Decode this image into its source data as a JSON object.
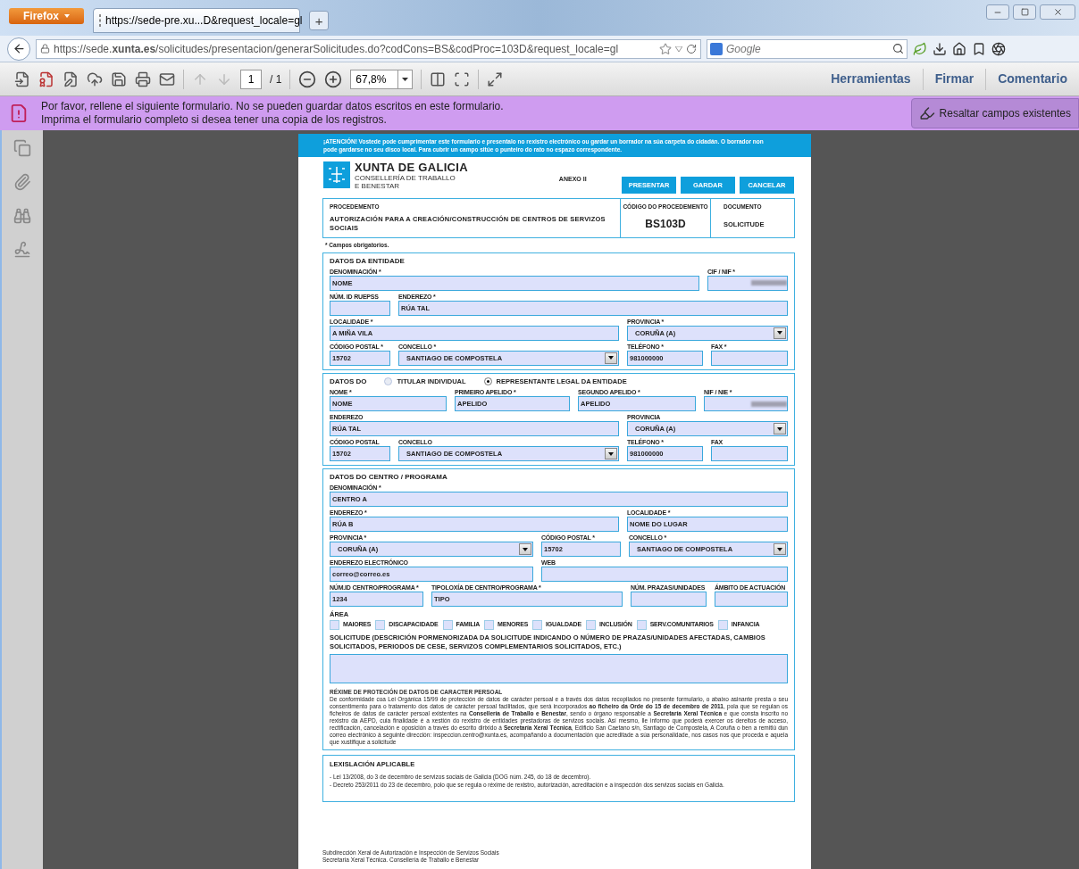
{
  "browser": {
    "menu_button": "Firefox",
    "tab": {
      "title": "https://sede-pre.xu...D&request_locale=gl",
      "new_tab": "+"
    },
    "address": "https://sede.**xunta.es**/solicitudes/presentacion/generarSolicitudes.do?codCons=BS&codProc=103D&request_locale=gl",
    "search": {
      "placeholder": "Google"
    }
  },
  "pdf_toolbar": {
    "page": "1",
    "page_count": "/ 1",
    "zoom": "67,8%",
    "menus": [
      "Herramientas",
      "Firmar",
      "Comentario"
    ]
  },
  "notice": {
    "lines": [
      "Por favor, rellene el siguiente formulario. No se pueden guardar datos escritos en este formulario.",
      "Imprima el formulario completo si desea tener una copia de los registros."
    ],
    "button": "Resaltar campos existentes"
  },
  "form": {
    "banner": "¡ATENCIÓN! Vostede pode cumprimentar este formulario e presentalo no rexistro electrónico ou gardar un borrador na súa carpeta do cidadán. O borrador non pode gardarse no seu disco local. Para cubrir un campo sitúe o punteiro do rato no espazo correspondente.",
    "logo": {
      "title": "XUNTA DE GALICIA",
      "subtitle": [
        "CONSELLERÍA DE TRABALLO",
        "E BENESTAR"
      ]
    },
    "annex": "ANEXO II",
    "buttons": [
      "PRESENTAR",
      "GARDAR",
      "CANCELAR"
    ],
    "procedure": {
      "label": "PROCEDEMENTO",
      "value": "AUTORIZACIÓN PARA A CREACIÓN/CONSTRUCCIÓN DE CENTROS DE SERVIZOS SOCIAIS"
    },
    "code": {
      "label": "CÓDIGO DO PROCEDEMENTO",
      "value": "BS103D"
    },
    "document": {
      "label": "DOCUMENTO",
      "value": "SOLICITUDE"
    },
    "required_note": "* Campos obrigatorios.",
    "sections": [
      {
        "title": "DATOS DA ENTIDADE",
        "rows": [
          {
            "fields": [
              {
                "kind": "text",
                "label": "DENOMINACIÓN *",
                "value": "NOME"
              },
              {
                "kind": "text",
                "label": "CIF / NIF *",
                "redacted": true
              }
            ]
          },
          {
            "fields": [
              {
                "kind": "text",
                "label": "NÚM. ID RUEPSS"
              },
              {
                "kind": "text",
                "label": "ENDEREZO *",
                "value": "RÚA TAL"
              }
            ]
          },
          {
            "fields": [
              {
                "kind": "text",
                "label": "LOCALIDADE *",
                "value": "A MIÑA VILA"
              },
              {
                "kind": "select",
                "label": "PROVINCIA *",
                "value": "CORUÑA (A)"
              }
            ]
          },
          {
            "fields": [
              {
                "kind": "text",
                "label": "CÓDIGO POSTAL *",
                "value": "15702"
              },
              {
                "kind": "select",
                "label": "CONCELLO *",
                "value": "SANTIAGO DE COMPOSTELA"
              },
              {
                "kind": "text",
                "label": "TELÉFONO *",
                "value": "981000000"
              },
              {
                "kind": "text",
                "label": "FAX *"
              }
            ]
          }
        ]
      },
      {
        "title": "DATOS DO",
        "options": [
          {
            "label": "TITULAR INDIVIDUAL",
            "selected": false
          },
          {
            "label": "REPRESENTANTE LEGAL DA ENTIDADE",
            "selected": true
          }
        ],
        "rows": [
          {
            "fields": [
              {
                "kind": "text",
                "label": "NOME *",
                "value": "NOME"
              },
              {
                "kind": "text",
                "label": "PRIMEIRO APELIDO *",
                "value": "APELIDO"
              },
              {
                "kind": "text",
                "label": "SEGUNDO APELIDO *",
                "value": "APELIDO"
              },
              {
                "kind": "text",
                "label": "NIF / NIE *",
                "redacted": true
              }
            ]
          },
          {
            "fields": [
              {
                "kind": "text",
                "label": "ENDEREZO",
                "value": "RÚA TAL"
              },
              {
                "kind": "select",
                "label": "PROVINCIA",
                "value": "CORUÑA (A)"
              }
            ]
          },
          {
            "fields": [
              {
                "kind": "text",
                "label": "CÓDIGO POSTAL",
                "value": "15702"
              },
              {
                "kind": "select",
                "label": "CONCELLO",
                "value": "SANTIAGO DE COMPOSTELA"
              },
              {
                "kind": "text",
                "label": "TELÉFONO *",
                "value": "981000000"
              },
              {
                "kind": "text",
                "label": "FAX"
              }
            ]
          }
        ]
      },
      {
        "title": "DATOS DO CENTRO / PROGRAMA",
        "rows": [
          {
            "fields": [
              {
                "kind": "text",
                "label": "DENOMINACIÓN *",
                "value": "CENTRO A"
              }
            ]
          },
          {
            "fields": [
              {
                "kind": "text",
                "label": "ENDEREZO *",
                "value": "RÚA B"
              },
              {
                "kind": "text",
                "label": "LOCALIDADE *",
                "value": "NOME DO LUGAR"
              }
            ]
          },
          {
            "fields": [
              {
                "kind": "select",
                "label": "PROVINCIA *",
                "value": "CORUÑA (A)"
              },
              {
                "kind": "text",
                "label": "CÓDIGO POSTAL *",
                "value": "15702"
              },
              {
                "kind": "select",
                "label": "CONCELLO *",
                "value": "SANTIAGO DE COMPOSTELA"
              }
            ]
          },
          {
            "fields": [
              {
                "kind": "text",
                "label": "ENDEREZO ELECTRÓNICO",
                "value": "correo@correo.es"
              },
              {
                "kind": "text",
                "label": "WEB"
              }
            ]
          },
          {
            "fields": [
              {
                "kind": "text",
                "label": "NÚM.ID CENTRO/PROGRAMA *",
                "value": "1234"
              },
              {
                "kind": "text",
                "label": "TIPOLOXÍA DE CENTRO/PROGRAMA *",
                "value": "TIPO"
              },
              {
                "kind": "text",
                "label": "NÚM. PRAZAS/UNIDADES"
              },
              {
                "kind": "text",
                "label": "ÁMBITO DE ACTUACIÓN"
              }
            ]
          }
        ],
        "area": {
          "label": "ÁREA",
          "options": [
            {
              "label": "MAIORES",
              "checked": false
            },
            {
              "label": "DISCAPACIDADE",
              "checked": false
            },
            {
              "label": "FAMILIA",
              "checked": false
            },
            {
              "label": "MENORES",
              "checked": false
            },
            {
              "label": "IGUALDADE",
              "checked": false
            },
            {
              "label": "INCLUSIÓN",
              "checked": false
            },
            {
              "label": "SERV.COMUNITARIOS",
              "checked": false
            },
            {
              "label": "INFANCIA",
              "checked": false
            }
          ]
        },
        "request": {
          "label": "SOLICITUDE (DESCRICIÓN PORMENORIZADA DA SOLICITUDE INDICANDO O NÚMERO DE PRAZAS/UNIDADES AFECTADAS, CAMBIOS SOLICITADOS, PERIODOS DE CESE, SERVIZOS COMPLEMENTARIOS SOLICITADOS, ETC.)"
        },
        "privacy": {
          "title": "RÉXIME DE PROTECIÓN DE DATOS DE CARACTER PERSOAL",
          "text": "De conformidade coa Lei Orgánica 15/99 de protección de datos de carácter persoal e a través dos datos recopilados no presente formulario, o abaixo asinante presta o seu consentimento para o tratamento dos datos de carácter persoal facilitados, que será incorporados **ao ficheiro da Orde do 15 de decembro de 2011**, pola que se regulan os ficheiros de datos de carácter persoal existentes na **Consellería de Traballo e Benestar**, sendo o órgano responsable a **Secretaría Xeral Técnica** e que consta inscrito no rexistro da AEPD, cuia finalidade é a xestión do rexistro de entidades prestadoras de servizos sociais. Así mesmo, lle informo que poderá exercer os dereitos de acceso, rectificación, cancelación e oposición a través do escrito dirixido á **Secretaría Xeral Técnica**, Edificio San Caetano s/n, Santiago de Compostela, A Coruña o ben a remitiú dun correo electrónico á seguinte dirección: inspeccion.centro@xunta.es, acompañando a documentación que acreditade a súa personalidade, nos casos nos que proceda e aquela que xustifique a solicitude"
        }
      }
    ],
    "legislation": {
      "title": "LEXISLACIÓN APLICABLE",
      "items": [
        "- Lei 13/2008, do 3 de decembro de servizos sociais de Galicia (DOG núm. 245, do 18 de decembro).",
        "- Decreto 253/2011 do 23 de decembro, polo que se regula o réxime de rexistro, autorización, acreditación e a inspección dos servizos sociais en Galicia."
      ]
    },
    "footer": [
      "Subdirección Xeral de Autorización e Inspección de Servizos Sociais",
      "Secretaría Xeral Técnica. Consellería de Traballo e Benestar"
    ]
  }
}
